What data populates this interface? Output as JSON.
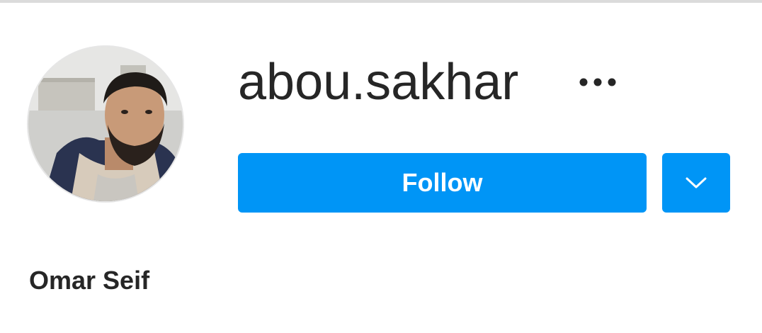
{
  "profile": {
    "username": "abou.sakhar",
    "full_name": "Omar Seif",
    "avatar_alt": "profile-photo"
  },
  "actions": {
    "follow_label": "Follow",
    "more_icon": "more-horizontal-icon",
    "dropdown_icon": "chevron-down-icon"
  },
  "colors": {
    "accent": "#0095f6",
    "text": "#262626",
    "divider": "#dbdbdb"
  }
}
